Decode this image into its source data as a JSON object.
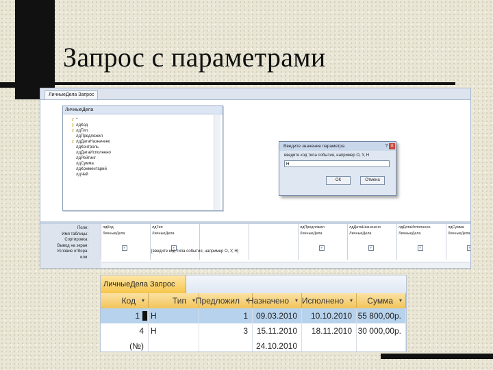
{
  "slide": {
    "title": "Запрос с параметрами"
  },
  "design_window": {
    "tab_label": "ЛичныеДела Запрос",
    "field_list": {
      "title": "ЛичныеДела",
      "fields": [
        {
          "key": true,
          "name": "*"
        },
        {
          "key": true,
          "name": "лдКод"
        },
        {
          "key": true,
          "name": "лдТип"
        },
        {
          "key": false,
          "name": "лдПредложил"
        },
        {
          "key": true,
          "name": "лдДатаНазначено"
        },
        {
          "key": false,
          "name": "лдКонтроль"
        },
        {
          "key": false,
          "name": "лдДатаИсполнено"
        },
        {
          "key": false,
          "name": "лдРейтинг"
        },
        {
          "key": false,
          "name": "лдСумма"
        },
        {
          "key": false,
          "name": "лдКомментарий"
        },
        {
          "key": false,
          "name": "лдЧей"
        }
      ]
    },
    "dialog": {
      "title": "Введите значение параметра",
      "help_glyph": "?",
      "close_glyph": "✕",
      "prompt": "введите код типа события, например О, У, Н",
      "input_value": "Н",
      "ok_label": "ОК",
      "cancel_label": "Отмена"
    },
    "grid": {
      "row_labels": [
        "Поле:",
        "Имя таблицы:",
        "Сортировка:",
        "Вывод на экран:",
        "Условие отбора:",
        "или:"
      ],
      "columns": [
        {
          "field": "лдКод",
          "table": "ЛичныеДела",
          "show": true
        },
        {
          "field": "лдТип",
          "table": "ЛичныеДела",
          "show": true
        },
        {
          "field": "",
          "table": "",
          "show": false
        },
        {
          "field": "",
          "table": "",
          "show": false
        },
        {
          "field": "лдПредложил",
          "table": "ЛичныеДела",
          "show": true
        },
        {
          "field": "лдДатаНазначено",
          "table": "ЛичныеДела",
          "show": true
        },
        {
          "field": "лдДатаИсполнено",
          "table": "ЛичныеДела",
          "show": true
        },
        {
          "field": "лдСумма",
          "table": "ЛичныеДела",
          "show": true
        }
      ],
      "criteria": "[введите код типа события, например О, У, Н]",
      "check_mark": "✓"
    }
  },
  "datasheet": {
    "tab_label": "ЛичныеДела Запрос",
    "columns": [
      "Код",
      "Тип",
      "Предложил",
      "Назначено",
      "Исполнено",
      "Сумма"
    ],
    "dropdown_glyph": "▾",
    "rows": [
      {
        "kod": "1",
        "tip": "Н",
        "predlozhil": "1",
        "naznacheno": "09.03.2010",
        "ispolneno": "10.10.2010",
        "summa": "55 800,00р."
      },
      {
        "kod": "4",
        "tip": "Н",
        "predlozhil": "3",
        "naznacheno": "15.11.2010",
        "ispolneno": "18.11.2010",
        "summa": "30 000,00р."
      },
      {
        "kod": "(№)",
        "tip": "",
        "predlozhil": "",
        "naznacheno": "24.10.2010",
        "ispolneno": "",
        "summa": ""
      }
    ]
  }
}
